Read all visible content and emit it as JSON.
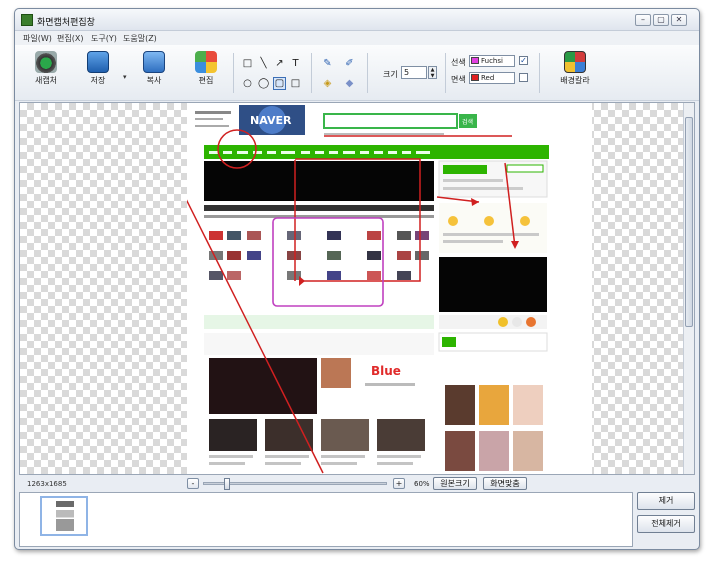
{
  "window": {
    "title": "화면캡처편집창",
    "buttons": [
      "–",
      "▢",
      "✕"
    ]
  },
  "menu": [
    "파일(W)",
    "편집(X)",
    "도구(Y)",
    "도움말(Z)"
  ],
  "toolbar": {
    "new_label": "새캡처",
    "save_label": "저장",
    "copy_label": "복사",
    "edit_label": "편집",
    "wallpaper_label": "배경칼라",
    "dropdown_glyph": "▾",
    "size_label": "크기",
    "size_value": "5",
    "line_color_label": "선색",
    "line_color_value": "Fuchsi",
    "face_color_label": "면색",
    "face_color_value": "Red",
    "line_color_checked": true,
    "face_color_checked": false,
    "colors": {
      "fuchsia": "#e040e0",
      "red": "#e02020"
    },
    "tools_row1": [
      "□",
      "╲",
      "↗",
      "T"
    ],
    "tools_row2": [
      "○",
      "◯",
      "▢",
      "□"
    ],
    "pen_tools": [
      "✎",
      "✐",
      "◈",
      "◆"
    ]
  },
  "capture": {
    "logo": "NAVER",
    "search_button": "검색",
    "annotation_color": "#d02020",
    "highlight_color": "#c040c0"
  },
  "status": {
    "dimensions": "1263x1685",
    "zoom_percent": "60%",
    "zoom_fraction": 0.6,
    "original_size_label": "원본크기",
    "fit_label": "화면맞춤",
    "minus_label": "-",
    "plus_label": "+"
  },
  "side_buttons": {
    "remove_label": "제거",
    "remove_all_label": "전체제거"
  }
}
